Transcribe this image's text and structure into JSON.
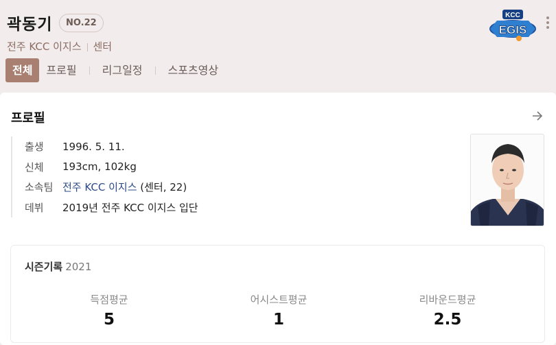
{
  "player": {
    "name": "곽동기",
    "number": "NO.22",
    "team": "전주 KCC 이지스",
    "position": "센터"
  },
  "tabs": [
    {
      "label": "전체",
      "active": true
    },
    {
      "label": "프로필",
      "active": false
    },
    {
      "label": "리그일정",
      "active": false
    },
    {
      "label": "스포츠영상",
      "active": false
    }
  ],
  "logo": {
    "top_text": "KCC",
    "main_text": "EGIS"
  },
  "profile": {
    "title": "프로필",
    "rows": [
      {
        "label": "출생",
        "value": "1996. 5. 11."
      },
      {
        "label": "신체",
        "value": "193cm, 102kg"
      },
      {
        "label": "소속팀",
        "link": "전주 KCC 이지스",
        "value": " (센터, 22)"
      },
      {
        "label": "데뷔",
        "value": "2019년 전주 KCC 이지스 입단"
      }
    ]
  },
  "season": {
    "title": "시즌기록",
    "year": "2021",
    "stats": [
      {
        "label": "득점평균",
        "value": "5"
      },
      {
        "label": "어시스트평균",
        "value": "1"
      },
      {
        "label": "리바운드평균",
        "value": "2.5"
      }
    ]
  },
  "colors": {
    "accent": "#a97f71",
    "link": "#2c4a8a",
    "header_bg": "#f2ecec"
  }
}
